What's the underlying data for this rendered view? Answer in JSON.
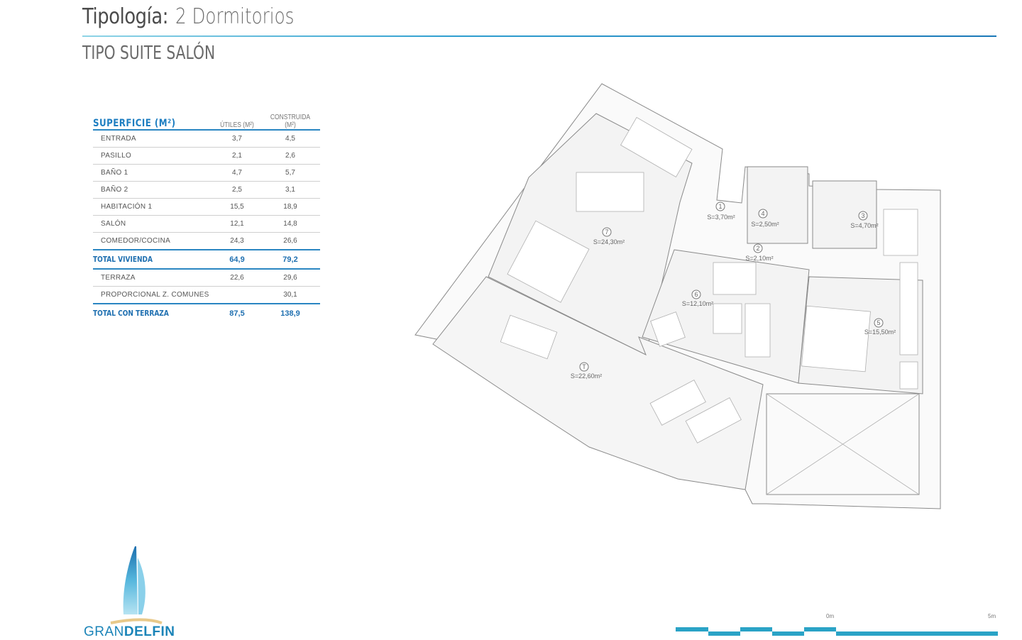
{
  "header": {
    "title_label": "Tipología:",
    "title_value": "2 Dormitorios",
    "subtitle": "TIPO SUITE SALÓN"
  },
  "surface_table": {
    "heading": "SUPERFICIE (M²)",
    "col_utiles": "ÚTILES (M²)",
    "col_construida": "CONSTRUIDA (M²)",
    "rows": [
      {
        "name": "ENTRADA",
        "utiles": "3,7",
        "construida": "4,5"
      },
      {
        "name": "PASILLO",
        "utiles": "2,1",
        "construida": "2,6"
      },
      {
        "name": "BAÑO 1",
        "utiles": "4,7",
        "construida": "5,7"
      },
      {
        "name": "BAÑO 2",
        "utiles": "2,5",
        "construida": "3,1"
      },
      {
        "name": "HABITACIÓN 1",
        "utiles": "15,5",
        "construida": "18,9"
      },
      {
        "name": "SALÓN",
        "utiles": "12,1",
        "construida": "14,8"
      },
      {
        "name": "COMEDOR/COCINA",
        "utiles": "24,3",
        "construida": "26,6"
      }
    ],
    "total_vivienda": {
      "name": "TOTAL VIVIENDA",
      "utiles": "64,9",
      "construida": "79,2"
    },
    "extra_rows": [
      {
        "name": "TERRAZA",
        "utiles": "22,6",
        "construida": "29,6"
      },
      {
        "name": "PROPORCIONAL Z. COMUNES",
        "utiles": "",
        "construida": "30,1"
      }
    ],
    "total_terraza": {
      "name": "TOTAL CON TERRAZA",
      "utiles": "87,5",
      "construida": "138,9"
    }
  },
  "plan": {
    "rooms": [
      {
        "id": "1",
        "area": "S=3,70m²"
      },
      {
        "id": "2",
        "area": "S=2,10m²"
      },
      {
        "id": "3",
        "area": "S=4,70m²"
      },
      {
        "id": "4",
        "area": "S=2,50m²"
      },
      {
        "id": "5",
        "area": "S=15,50m²"
      },
      {
        "id": "6",
        "area": "S=12,10m²"
      },
      {
        "id": "7",
        "area": "S=24,30m²"
      },
      {
        "id": "T",
        "area": "S=22,60m²"
      }
    ]
  },
  "logo": {
    "word1": "GRAN",
    "word2": "DELFIN"
  },
  "scale": {
    "start": "0m",
    "end": "5m"
  },
  "colors": {
    "accent": "#1e7ec1",
    "rule": "#2f9fd0",
    "plan_fill": "#f3f3f3",
    "plan_line": "#8a8a8a"
  }
}
